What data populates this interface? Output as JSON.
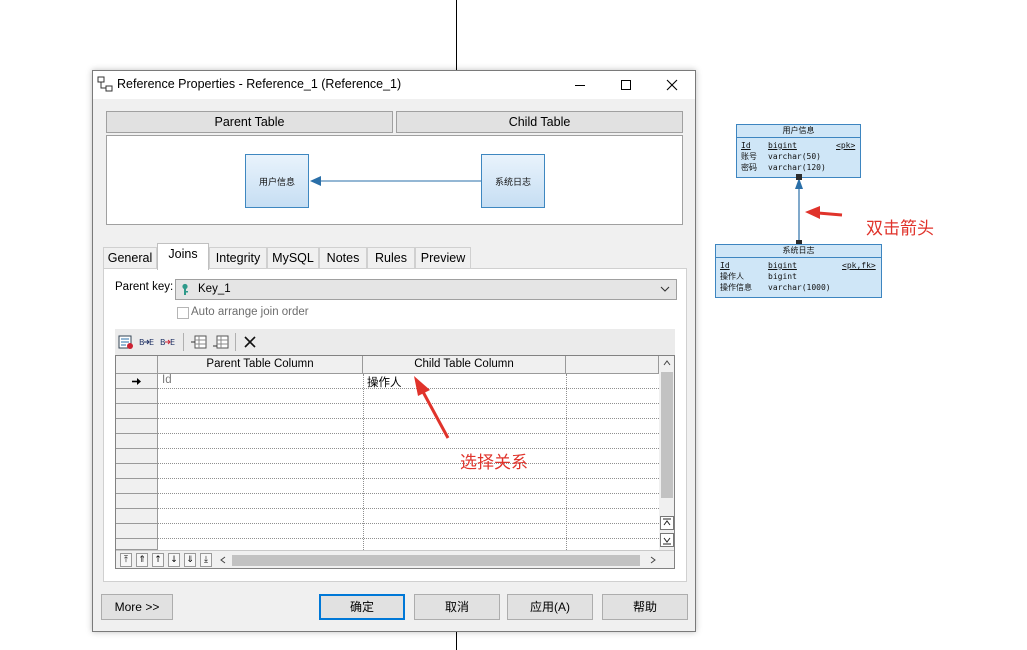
{
  "dialog": {
    "title": "Reference Properties - Reference_1 (Reference_1)",
    "header_parent": "Parent Table",
    "header_child": "Child Table",
    "diagram_parent": "用户信息",
    "diagram_child": "系统日志"
  },
  "tabs": [
    {
      "label": "General"
    },
    {
      "label": "Joins"
    },
    {
      "label": "Integrity"
    },
    {
      "label": "MySQL"
    },
    {
      "label": "Notes"
    },
    {
      "label": "Rules"
    },
    {
      "label": "Preview"
    }
  ],
  "joins": {
    "parent_key_label": "Parent key:",
    "parent_key_value": "Key_1",
    "auto_arrange_label": "Auto arrange join order",
    "columns": [
      "Parent Table Column",
      "Child Table Column"
    ],
    "rows": [
      {
        "parent": "Id",
        "child": "操作人"
      }
    ]
  },
  "buttons": {
    "more": "More >>",
    "ok": "确定",
    "cancel": "取消",
    "apply": "应用(A)",
    "help": "帮助"
  },
  "er": {
    "user_table": {
      "name": "用户信息",
      "rows": [
        {
          "col": "Id",
          "type": "bigint",
          "key": "<pk>"
        },
        {
          "col": "账号",
          "type": "varchar(50)",
          "key": ""
        },
        {
          "col": "密码",
          "type": "varchar(120)",
          "key": ""
        }
      ]
    },
    "log_table": {
      "name": "系统日志",
      "rows": [
        {
          "col": "Id",
          "type": "bigint",
          "key": "<pk,fk>"
        },
        {
          "col": "操作人",
          "type": "bigint",
          "key": ""
        },
        {
          "col": "操作信息",
          "type": "varchar(1000)",
          "key": ""
        }
      ]
    }
  },
  "annotations": {
    "double_click": "双击箭头",
    "select_relation": "选择关系"
  },
  "colors": {
    "annotation": "#e0332b",
    "table_fill": "#cfe6f7",
    "table_border": "#3d85c0",
    "primary_focus": "#0078d7"
  }
}
